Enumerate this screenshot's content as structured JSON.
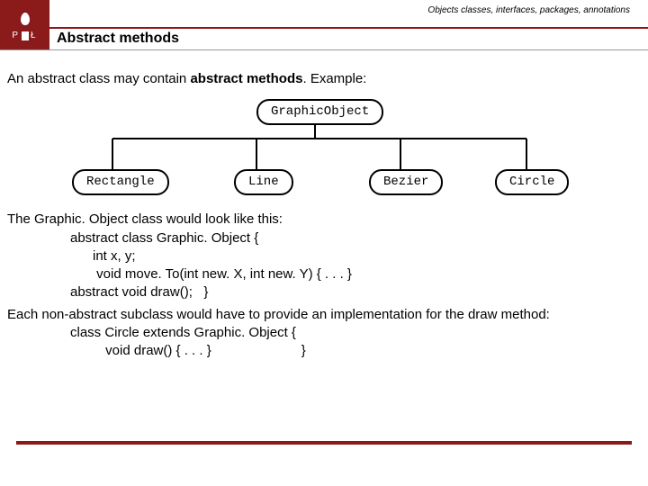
{
  "header": {
    "breadcrumb": "Objects classes, interfaces, packages, annotations",
    "title": "Abstract methods",
    "logo_left": "P",
    "logo_right": "Ł"
  },
  "body": {
    "intro_prefix": "An abstract class may contain ",
    "intro_bold": "abstract methods",
    "intro_suffix": ". Example:",
    "diagram": {
      "parent": "GraphicObject",
      "children": [
        "Rectangle",
        "Line",
        "Bezier",
        "Circle"
      ]
    },
    "p1": "The Graphic. Object class would look like this:",
    "code1_l1": "abstract class Graphic. Object {",
    "code1_l2": "int x, y;",
    "code1_l3": " void move. To(int new. X, int new. Y) { . . . }",
    "code1_l4": "abstract void draw();   }",
    "p2": "Each non-abstract subclass would have to provide an implementation for the draw method:",
    "code2_l1": "class Circle extends Graphic. Object {",
    "code2_l2": " void draw() { . . . }                        }"
  }
}
